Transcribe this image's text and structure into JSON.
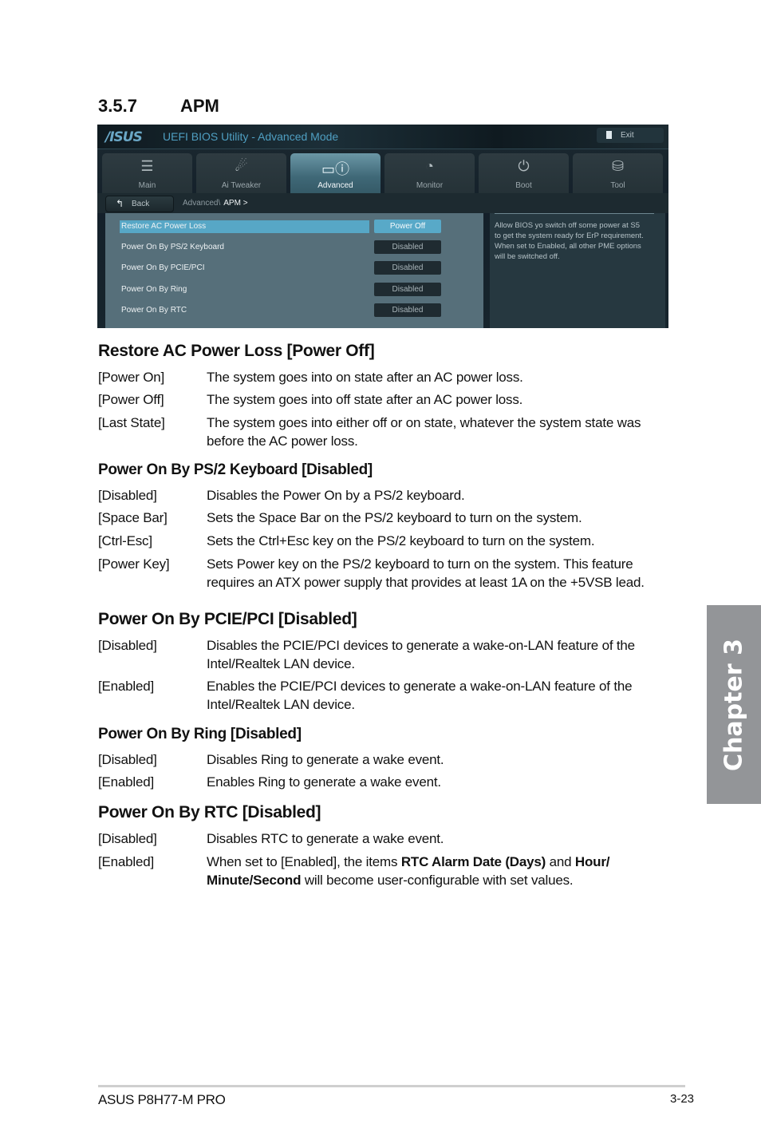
{
  "section": {
    "number": "3.5.7",
    "title": "APM"
  },
  "bios": {
    "logo": "/ISUS",
    "window_title": "UEFI BIOS Utility - Advanced Mode",
    "exit_label": "Exit",
    "tabs": [
      {
        "label": "Main",
        "icon": "list-icon",
        "active": false
      },
      {
        "label": "Ai  Tweaker",
        "icon": "ai-tweaker-icon",
        "active": false
      },
      {
        "label": "Advanced",
        "icon": "advanced-info-icon",
        "active": true
      },
      {
        "label": "Monitor",
        "icon": "monitor-thermometer-icon",
        "active": false
      },
      {
        "label": "Boot",
        "icon": "power-icon",
        "active": false
      },
      {
        "label": "Tool",
        "icon": "toolbox-icon",
        "active": false
      }
    ],
    "back_label": "Back",
    "breadcrumb": {
      "path": "Advanced\\",
      "current": "APM  >"
    },
    "settings": [
      {
        "label": "Restore AC Power Loss",
        "value": "Power Off",
        "selected": true
      },
      {
        "label": "Power On By PS/2 Keyboard",
        "value": "Disabled",
        "selected": false
      },
      {
        "label": "Power On By PCIE/PCI",
        "value": "Disabled",
        "selected": false
      },
      {
        "label": "Power On By Ring",
        "value": "Disabled",
        "selected": false
      },
      {
        "label": "Power On By RTC",
        "value": "Disabled",
        "selected": false
      }
    ],
    "help_text": "Allow BIOS yo switch off some power at S5 to get the system ready for ErP requirement. When set to Enabled, all other PME options will be switched off.",
    "colors": {
      "highlight": "#57a7c6",
      "title": "#4f9fc2",
      "panel": "#566f7a"
    }
  },
  "sections": [
    {
      "heading": "Restore AC Power Loss [Power Off]",
      "options": [
        {
          "key": "[Power On]",
          "desc": "The system goes into on state after an AC power loss."
        },
        {
          "key": "[Power Off]",
          "desc": "The system goes into off state after an AC power loss."
        },
        {
          "key": "[Last State]",
          "desc": "The system goes into either off or on state, whatever the system state was before the AC power loss."
        }
      ]
    },
    {
      "heading": "Power On By PS/2 Keyboard [Disabled]",
      "options": [
        {
          "key": "[Disabled]",
          "desc": "Disables the Power On by a PS/2 keyboard."
        },
        {
          "key": "[Space Bar]",
          "desc": "Sets the Space Bar on the PS/2 keyboard to turn on the system."
        },
        {
          "key": "[Ctrl-Esc]",
          "desc": "Sets the Ctrl+Esc key on the PS/2 keyboard to turn on the system."
        },
        {
          "key": "[Power Key]",
          "desc": "Sets Power key on the PS/2 keyboard to turn on the system. This feature requires an ATX power supply that provides at least 1A on the +5VSB lead."
        }
      ]
    },
    {
      "heading": "Power On By PCIE/PCI [Disabled]",
      "options": [
        {
          "key": "[Disabled]",
          "desc": "Disables the PCIE/PCI devices to generate a wake-on-LAN feature of the Intel/Realtek LAN device."
        },
        {
          "key": "[Enabled]",
          "desc": "Enables the PCIE/PCI devices to generate a wake-on-LAN feature of the Intel/Realtek LAN device."
        }
      ]
    },
    {
      "heading": "Power On By Ring [Disabled]",
      "options": [
        {
          "key": "[Disabled]",
          "desc": "Disables Ring to generate a wake event."
        },
        {
          "key": "[Enabled]",
          "desc": "Enables Ring to generate a wake event."
        }
      ]
    },
    {
      "heading": "Power On By RTC [Disabled]",
      "options": [
        {
          "key": "[Disabled]",
          "desc": "Disables RTC to generate a wake event."
        },
        {
          "key": "[Enabled]",
          "desc_parts": [
            {
              "text": "When set to [Enabled], the items ",
              "bold": false
            },
            {
              "text": "RTC Alarm Date (Days)",
              "bold": true
            },
            {
              "text": " and ",
              "bold": false
            },
            {
              "text": "Hour/ Minute/Second",
              "bold": true
            },
            {
              "text": " will become user-configurable with set values.",
              "bold": false
            }
          ]
        }
      ]
    }
  ],
  "chapter_tab": "Chapter 3",
  "footer": {
    "product": "ASUS P8H77-M PRO",
    "page": "3-23"
  }
}
